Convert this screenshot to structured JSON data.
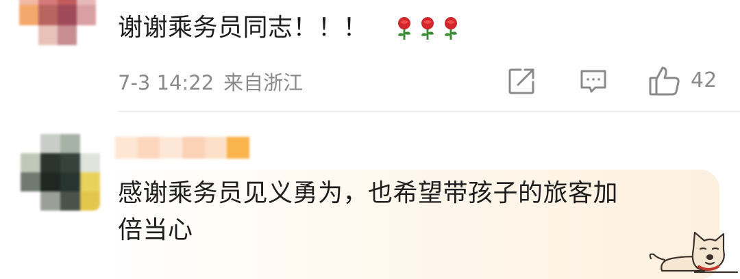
{
  "comments": [
    {
      "text": "谢谢乘务员同志！！！",
      "emoji": [
        "🌹",
        "🌹",
        "🌹"
      ],
      "date": "7-3 14:22",
      "location": "来自浙江",
      "like_count": "42"
    },
    {
      "lines": [
        "感谢乘务员见义勇为，也希望带孩子的旅客加",
        "倍当心"
      ]
    }
  ],
  "icons": {
    "repost": "repost-icon",
    "reply": "comment-icon",
    "like": "thumbs-up-icon",
    "rose": "rose-icon",
    "sticker": "dog-sticker"
  },
  "colors": {
    "text": "#1e1e1e",
    "meta": "#8a8a8a",
    "divider": "#eeeeee",
    "bubble": "#fdf0df"
  }
}
